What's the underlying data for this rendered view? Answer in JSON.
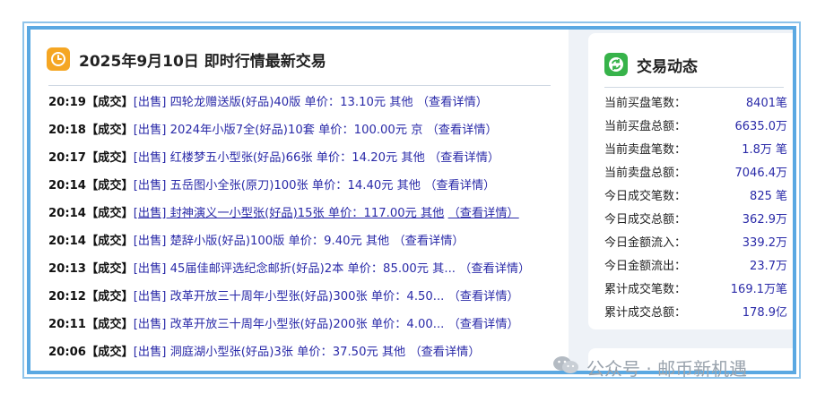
{
  "left_panel": {
    "title": "2025年9月10日 即时行情最新交易",
    "icon": "clock-icon",
    "trades": [
      {
        "time": "20:19",
        "status": "【成交】",
        "desc": "[出售] 四轮龙赠送版(好品)40版 单价：13.10元 其他",
        "link": "（查看详情）",
        "underlined": false
      },
      {
        "time": "20:18",
        "status": "【成交】",
        "desc": "[出售] 2024年小版7全(好品)10套 单价：100.00元 京",
        "link": "（查看详情）",
        "underlined": false
      },
      {
        "time": "20:17",
        "status": "【成交】",
        "desc": "[出售] 红楼梦五小型张(好品)66张 单价：14.20元 其他",
        "link": "（查看详情）",
        "underlined": false
      },
      {
        "time": "20:14",
        "status": "【成交】",
        "desc": "[出售] 五岳图小全张(原刀)100张 单价：14.40元 其他",
        "link": "（查看详情）",
        "underlined": false
      },
      {
        "time": "20:14",
        "status": "【成交】",
        "desc": "[出售] 封神演义一小型张(好品)15张 单价：117.00元 其他",
        "link": "（查看详情）",
        "underlined": true
      },
      {
        "time": "20:14",
        "status": "【成交】",
        "desc": "[出售] 楚辞小版(好品)100版 单价：9.40元 其他",
        "link": "（查看详情）",
        "underlined": false
      },
      {
        "time": "20:13",
        "status": "【成交】",
        "desc": "[出售] 45届佳邮评选纪念邮折(好品)2本 单价：85.00元 其...",
        "link": "（查看详情）",
        "underlined": false
      },
      {
        "time": "20:12",
        "status": "【成交】",
        "desc": "[出售] 改革开放三十周年小型张(好品)300张 单价：4.50...",
        "link": "（查看详情）",
        "underlined": false
      },
      {
        "time": "20:11",
        "status": "【成交】",
        "desc": "[出售] 改革开放三十周年小型张(好品)200张 单价：4.00...",
        "link": "（查看详情）",
        "underlined": false
      },
      {
        "time": "20:06",
        "status": "【成交】",
        "desc": "[出售] 洞庭湖小型张(好品)3张 单价：37.50元 其他",
        "link": "（查看详情）",
        "underlined": false
      }
    ]
  },
  "right_panel": {
    "title": "交易动态",
    "icon": "refresh-icon",
    "stats": [
      {
        "label": "当前买盘笔数：",
        "value": "8401笔"
      },
      {
        "label": "当前买盘总额：",
        "value": "6635.0万"
      },
      {
        "label": "当前卖盘笔数：",
        "value": "1.8万 笔"
      },
      {
        "label": "当前卖盘总额：",
        "value": "7046.4万"
      },
      {
        "label": "今日成交笔数：",
        "value": "825 笔"
      },
      {
        "label": "今日成交总额：",
        "value": "362.9万"
      },
      {
        "label": "今日金额流入：",
        "value": "339.2万"
      },
      {
        "label": "今日金额流出：",
        "value": "23.7万"
      },
      {
        "label": "累计成交笔数：",
        "value": "169.1万笔"
      },
      {
        "label": "累计成交总额：",
        "value": "178.9亿"
      }
    ]
  },
  "watermark": {
    "text": "公众号 · 邮币新机遇",
    "icon": "wechat-icon"
  },
  "colors": {
    "frame": "#5aa8e2",
    "link": "#2a2aa8",
    "clock_icon_bg": "#f5a623",
    "refresh_icon_bg": "#37b34a"
  }
}
